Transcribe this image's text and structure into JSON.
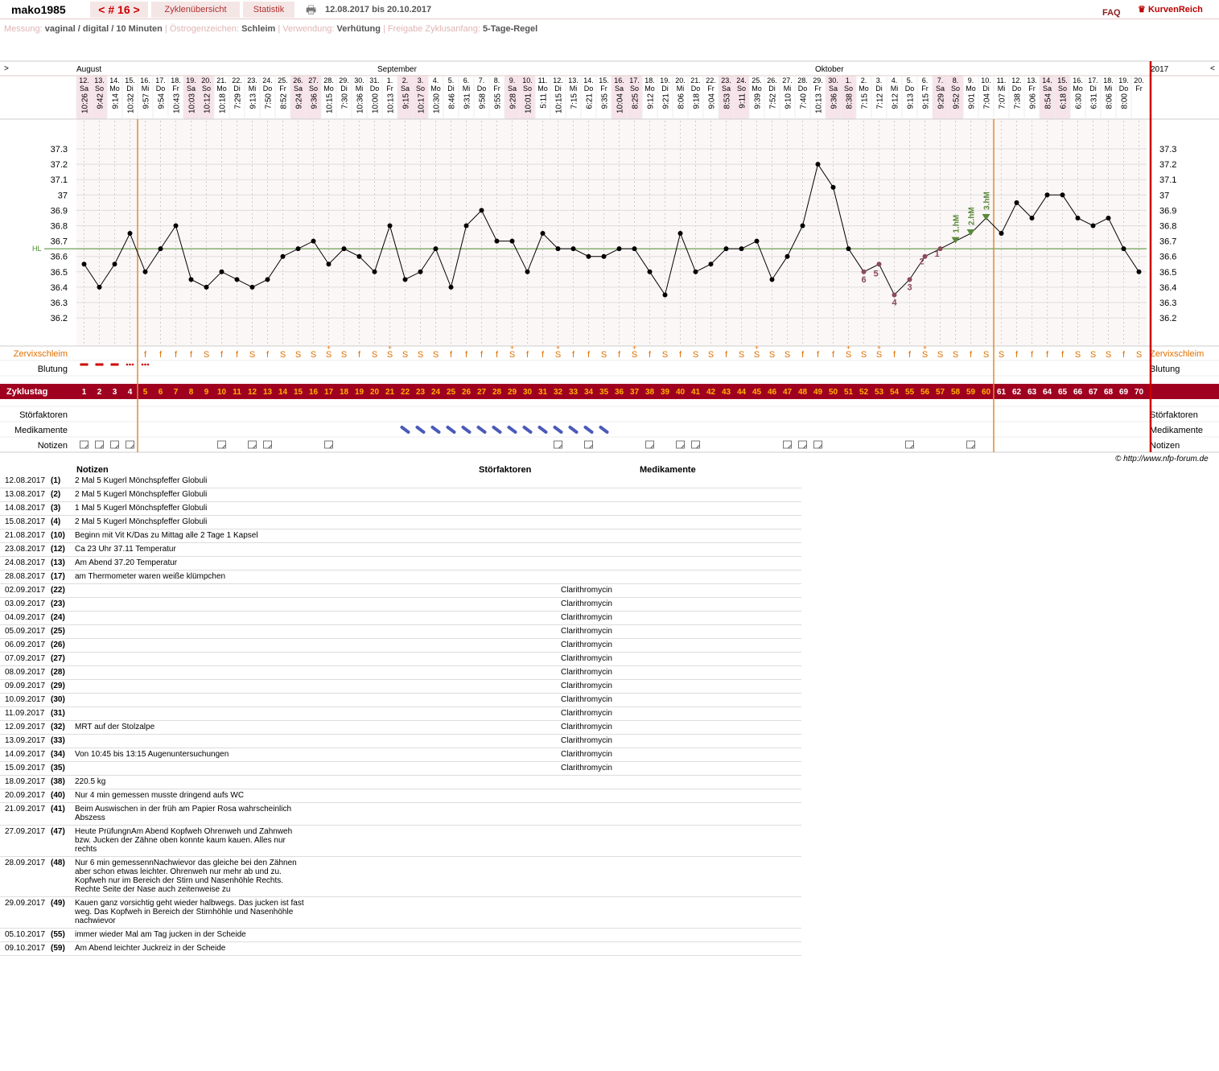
{
  "header": {
    "username": "mako1985",
    "cycle_nav": "< # 16 >",
    "overview_tab": "Zyklenübersicht",
    "stats_tab": "Statistik",
    "date_range": "12.08.2017 bis 20.10.2017",
    "faq": "FAQ",
    "brand": "KurvenReich"
  },
  "meta": [
    {
      "label": "Messung:",
      "value": "vaginal / digital / 10 Minuten"
    },
    {
      "label": "Östrogenzeichen:",
      "value": "Schleim"
    },
    {
      "label": "Verwendung:",
      "value": "Verhütung"
    },
    {
      "label": "Freigabe Zyklusanfang:",
      "value": "5-Tage-Regel"
    }
  ],
  "chart_data": {
    "type": "line",
    "title": "",
    "year": "2017",
    "nav_prev": ">",
    "nav_next": "<",
    "months": [
      {
        "name": "August",
        "day": 1
      },
      {
        "name": "September",
        "day": 22
      },
      {
        "name": "Oktober",
        "day": 51
      }
    ],
    "x": [
      1,
      2,
      3,
      4,
      5,
      6,
      7,
      8,
      9,
      10,
      11,
      12,
      13,
      14,
      15,
      16,
      17,
      18,
      19,
      20,
      21,
      22,
      23,
      24,
      25,
      26,
      27,
      28,
      29,
      30,
      31,
      32,
      33,
      34,
      35,
      36,
      37,
      38,
      39,
      40,
      41,
      42,
      43,
      44,
      45,
      46,
      47,
      48,
      49,
      50,
      51,
      52,
      53,
      54,
      55,
      56,
      57,
      58,
      59,
      60,
      61,
      62,
      63,
      64,
      65,
      66,
      67,
      68,
      69,
      70
    ],
    "dates": [
      "12.",
      "13.",
      "14.",
      "15.",
      "16.",
      "17.",
      "18.",
      "19.",
      "20.",
      "21.",
      "22.",
      "23.",
      "24.",
      "25.",
      "26.",
      "27.",
      "28.",
      "29.",
      "30.",
      "31.",
      "1.",
      "2.",
      "3.",
      "4.",
      "5.",
      "6.",
      "7.",
      "8.",
      "9.",
      "10.",
      "11.",
      "12.",
      "13.",
      "14.",
      "15.",
      "16.",
      "17.",
      "18.",
      "19.",
      "20.",
      "21.",
      "22.",
      "23.",
      "24.",
      "25.",
      "26.",
      "27.",
      "28.",
      "29.",
      "30.",
      "1.",
      "2.",
      "3.",
      "4.",
      "5.",
      "6.",
      "7.",
      "8.",
      "9.",
      "10.",
      "11.",
      "12.",
      "13.",
      "14.",
      "15.",
      "16.",
      "17.",
      "18.",
      "19.",
      "20."
    ],
    "weekdays": [
      "Sa",
      "So",
      "Mo",
      "Di",
      "Mi",
      "Do",
      "Fr",
      "Sa",
      "So",
      "Mo",
      "Di",
      "Mi",
      "Do",
      "Fr",
      "Sa",
      "So",
      "Mo",
      "Di",
      "Mi",
      "Do",
      "Fr",
      "Sa",
      "So",
      "Mo",
      "Di",
      "Mi",
      "Do",
      "Fr",
      "Sa",
      "So",
      "Mo",
      "Di",
      "Mi",
      "Do",
      "Fr",
      "Sa",
      "So",
      "Mo",
      "Di",
      "Mi",
      "Do",
      "Fr",
      "Sa",
      "So",
      "Mo",
      "Di",
      "Mi",
      "Do",
      "Fr",
      "Sa",
      "So",
      "Mo",
      "Di",
      "Mi",
      "Do",
      "Fr",
      "Sa",
      "So",
      "Mo",
      "Di",
      "Mi",
      "Do",
      "Fr",
      "Sa",
      "So",
      "Mo",
      "Di",
      "Mi",
      "Do",
      "Fr"
    ],
    "times": [
      "10:26",
      "9:42",
      "9:14",
      "10:32",
      "9:57",
      "9:54",
      "10:43",
      "10:03",
      "10:12",
      "10:18",
      "7:29",
      "9:13",
      "7:50",
      "8:52",
      "9:24",
      "9:36",
      "10:15",
      "7:30",
      "10:36",
      "10:00",
      "10:13",
      "9:15",
      "10:17",
      "10:30",
      "8:46",
      "9:31",
      "9:58",
      "9:55",
      "9:28",
      "10:01",
      "5:11",
      "10:15",
      "7:15",
      "6:21",
      "9:35",
      "10:04",
      "8:25",
      "9:12",
      "9:21",
      "8:06",
      "9:18",
      "9:04",
      "8:53",
      "9:11",
      "9:39",
      "7:52",
      "9:10",
      "7:40",
      "10:13",
      "9:36",
      "8:38",
      "7:15",
      "7:12",
      "9:12",
      "9:13",
      "9:15",
      "9:29",
      "9:52",
      "9:01",
      "7:04",
      "7:07",
      "7:38",
      "9:06",
      "8:54",
      "6:18",
      "6:30",
      "6:31",
      "8:06",
      "8:00"
    ],
    "temps": [
      36.55,
      36.4,
      36.55,
      36.75,
      36.5,
      36.65,
      36.8,
      36.45,
      36.4,
      36.5,
      36.45,
      36.4,
      36.45,
      36.6,
      36.65,
      36.7,
      36.55,
      36.65,
      36.6,
      36.5,
      36.8,
      36.45,
      36.5,
      36.65,
      36.4,
      36.8,
      36.9,
      36.7,
      36.7,
      36.5,
      36.75,
      36.65,
      36.65,
      36.6,
      36.6,
      36.65,
      36.65,
      36.5,
      36.35,
      36.75,
      36.5,
      36.55,
      36.65,
      36.65,
      36.7,
      36.45,
      36.6,
      36.8,
      37.2,
      37.05,
      36.65,
      36.5,
      36.55,
      36.35,
      36.45,
      36.6,
      36.65,
      36.7,
      36.75,
      36.85,
      36.75,
      36.95,
      36.85,
      37.0,
      37.0,
      36.85,
      36.8,
      36.85,
      36.65,
      36.5
    ],
    "yticks": [
      37.3,
      37.2,
      37.1,
      37,
      36.9,
      36.8,
      36.7,
      36.6,
      36.5,
      36.4,
      36.3,
      36.2
    ],
    "ylim": [
      36.1,
      37.4
    ],
    "hl_label": "HL",
    "coverline": 36.65,
    "lowlabels": [
      {
        "day": 52,
        "text": "6"
      },
      {
        "day": 53,
        "text": "5"
      },
      {
        "day": 54,
        "text": "4"
      },
      {
        "day": 55,
        "text": "3"
      },
      {
        "day": 56,
        "text": "2"
      },
      {
        "day": 57,
        "text": "1"
      }
    ],
    "highmarks": [
      {
        "day": 58,
        "text": "1.hM"
      },
      {
        "day": 59,
        "text": "2.hM"
      },
      {
        "day": 60,
        "text": "3.hM"
      }
    ],
    "cycle_start_marker_day": 5,
    "ovulation_marker_day": 60,
    "mucus": [
      "",
      "",
      "",
      "",
      "f",
      "f",
      "f",
      "f",
      "S",
      "f",
      "f",
      "S",
      "f",
      "S",
      "S",
      "S",
      "S+",
      "S",
      "f",
      "S",
      "S+",
      "S",
      "S",
      "S",
      "f",
      "f",
      "f",
      "f",
      "S+",
      "f",
      "f",
      "S+",
      "f",
      "f",
      "S",
      "f",
      "S+",
      "f",
      "S",
      "f",
      "S",
      "S",
      "f",
      "S",
      "S+",
      "S",
      "S",
      "f",
      "f",
      "f",
      "S+",
      "S",
      "S+",
      "f",
      "f",
      "S+",
      "S",
      "S",
      "f",
      "S",
      "S",
      "f",
      "f",
      "f",
      "f",
      "S",
      "S",
      "S",
      "f",
      "S"
    ],
    "bleeding": [
      "dash",
      "dash",
      "dash",
      "dots",
      "dots",
      "",
      "",
      "",
      "",
      "",
      "",
      "",
      "",
      "",
      "",
      "",
      "",
      "",
      "",
      "",
      "",
      "",
      "",
      "",
      "",
      "",
      "",
      "",
      "",
      "",
      "",
      "",
      "",
      "",
      "",
      "",
      "",
      "",
      "",
      "",
      "",
      "",
      "",
      "",
      "",
      "",
      "",
      "",
      "",
      "",
      "",
      "",
      "",
      "",
      "",
      "",
      "",
      "",
      "",
      "",
      "",
      "",
      "",
      "",
      "",
      "",
      "",
      "",
      "",
      ""
    ],
    "meds_days": [
      22,
      23,
      24,
      25,
      26,
      27,
      28,
      29,
      30,
      31,
      32,
      33,
      34,
      35
    ],
    "notes_days": [
      1,
      2,
      3,
      4,
      10,
      12,
      13,
      17,
      32,
      34,
      38,
      40,
      41,
      47,
      48,
      49,
      55,
      59
    ],
    "row_labels": {
      "mucus": "Zervixschleim",
      "bleeding": "Blutung",
      "cycle": "Zyklustag",
      "disturb": "Störfaktoren",
      "meds": "Medikamente",
      "notes": "Notizen"
    },
    "colors": {
      "line": "#000000",
      "dot": "#000000",
      "low": "#8a4a5a",
      "high": "#5a8a3a",
      "hl": "#4a8a2a",
      "cycle_bar": "#a00020",
      "mucus": "#e07000",
      "marker": "#e08a30",
      "cycle_end": "#cc0000",
      "meds": "#4a5ab8",
      "weekend_bg": "#f6e4ea",
      "plot_bg": "#fcf7f7"
    }
  },
  "notes_header": {
    "notes": "Notizen",
    "disturb": "Störfaktoren",
    "meds": "Medikamente"
  },
  "notes": [
    {
      "date": "12.08.2017",
      "day": "(1)",
      "note": "2 Mal 5 Kugerl Mönchspfeffer Globuli",
      "disturb": "",
      "meds": ""
    },
    {
      "date": "13.08.2017",
      "day": "(2)",
      "note": "2 Mal 5 Kugerl Mönchspfeffer Globuli",
      "disturb": "",
      "meds": ""
    },
    {
      "date": "14.08.2017",
      "day": "(3)",
      "note": "1 Mal 5 Kugerl Mönchspfeffer Globuli",
      "disturb": "",
      "meds": ""
    },
    {
      "date": "15.08.2017",
      "day": "(4)",
      "note": "2 Mal 5 Kugerl Mönchspfeffer Globuli",
      "disturb": "",
      "meds": ""
    },
    {
      "date": "21.08.2017",
      "day": "(10)",
      "note": "Beginn mit Vit K/Das zu Mittag alle 2 Tage 1 Kapsel",
      "disturb": "",
      "meds": ""
    },
    {
      "date": "23.08.2017",
      "day": "(12)",
      "note": "Ca 23 Uhr 37.11 Temperatur",
      "disturb": "",
      "meds": ""
    },
    {
      "date": "24.08.2017",
      "day": "(13)",
      "note": "Am Abend 37.20 Temperatur",
      "disturb": "",
      "meds": ""
    },
    {
      "date": "28.08.2017",
      "day": "(17)",
      "note": "am Thermometer  waren weiße  klümpchen",
      "disturb": "",
      "meds": ""
    },
    {
      "date": "02.09.2017",
      "day": "(22)",
      "note": "",
      "disturb": "",
      "meds": "Clarithromycin"
    },
    {
      "date": "03.09.2017",
      "day": "(23)",
      "note": "",
      "disturb": "",
      "meds": "Clarithromycin"
    },
    {
      "date": "04.09.2017",
      "day": "(24)",
      "note": "",
      "disturb": "",
      "meds": "Clarithromycin"
    },
    {
      "date": "05.09.2017",
      "day": "(25)",
      "note": "",
      "disturb": "",
      "meds": "Clarithromycin"
    },
    {
      "date": "06.09.2017",
      "day": "(26)",
      "note": "",
      "disturb": "",
      "meds": "Clarithromycin"
    },
    {
      "date": "07.09.2017",
      "day": "(27)",
      "note": "",
      "disturb": "",
      "meds": "Clarithromycin"
    },
    {
      "date": "08.09.2017",
      "day": "(28)",
      "note": "",
      "disturb": "",
      "meds": "Clarithromycin"
    },
    {
      "date": "09.09.2017",
      "day": "(29)",
      "note": "",
      "disturb": "",
      "meds": "Clarithromycin"
    },
    {
      "date": "10.09.2017",
      "day": "(30)",
      "note": "",
      "disturb": "",
      "meds": "Clarithromycin"
    },
    {
      "date": "11.09.2017",
      "day": "(31)",
      "note": "",
      "disturb": "",
      "meds": "Clarithromycin"
    },
    {
      "date": "12.09.2017",
      "day": "(32)",
      "note": "MRT auf der Stolzalpe",
      "disturb": "",
      "meds": "Clarithromycin"
    },
    {
      "date": "13.09.2017",
      "day": "(33)",
      "note": "",
      "disturb": "",
      "meds": "Clarithromycin"
    },
    {
      "date": "14.09.2017",
      "day": "(34)",
      "note": "Von 10:45 bis 13:15 Augenuntersuchungen",
      "disturb": "",
      "meds": "Clarithromycin"
    },
    {
      "date": "15.09.2017",
      "day": "(35)",
      "note": "",
      "disturb": "",
      "meds": "Clarithromycin"
    },
    {
      "date": "18.09.2017",
      "day": "(38)",
      "note": "220.5 kg",
      "disturb": "",
      "meds": ""
    },
    {
      "date": "20.09.2017",
      "day": "(40)",
      "note": "Nur 4 min gemessen musste dringend aufs WC",
      "disturb": "",
      "meds": ""
    },
    {
      "date": "21.09.2017",
      "day": "(41)",
      "note": "Beim Auswischen in der früh am Papier  Rosa wahrscheinlich Abszess",
      "disturb": "",
      "meds": ""
    },
    {
      "date": "27.09.2017",
      "day": "(47)",
      "note": "Heute PrüfungnAm Abend Kopfweh Ohrenweh und Zahnweh bzw. Jucken der Zähne oben konnte kaum kauen. Alles nur rechts",
      "disturb": "",
      "meds": ""
    },
    {
      "date": "28.09.2017",
      "day": "(48)",
      "note": "Nur 6 min gemessennNachwievor das gleiche bei den Zähnen aber schon etwas leichter. Ohrenweh nur mehr ab und zu. Kopfweh nur im Bereich der Stirn und Nasenhöhle Rechts. Rechte Seite der Nase auch zeitenweise zu",
      "disturb": "",
      "meds": ""
    },
    {
      "date": "29.09.2017",
      "day": "(49)",
      "note": "Kauen ganz vorsichtig geht wieder halbwegs. Das jucken ist fast  weg. Das Kopfweh in Bereich der Stirnhöhle und Nasenhöhle nachwievor",
      "disturb": "",
      "meds": ""
    },
    {
      "date": "05.10.2017",
      "day": "(55)",
      "note": "immer wieder Mal am Tag jucken in der Scheide",
      "disturb": "",
      "meds": ""
    },
    {
      "date": "09.10.2017",
      "day": "(59)",
      "note": "Am Abend leichter Juckreiz in der Scheide",
      "disturb": "",
      "meds": ""
    }
  ],
  "copyright": "© http://www.nfp-forum.de"
}
